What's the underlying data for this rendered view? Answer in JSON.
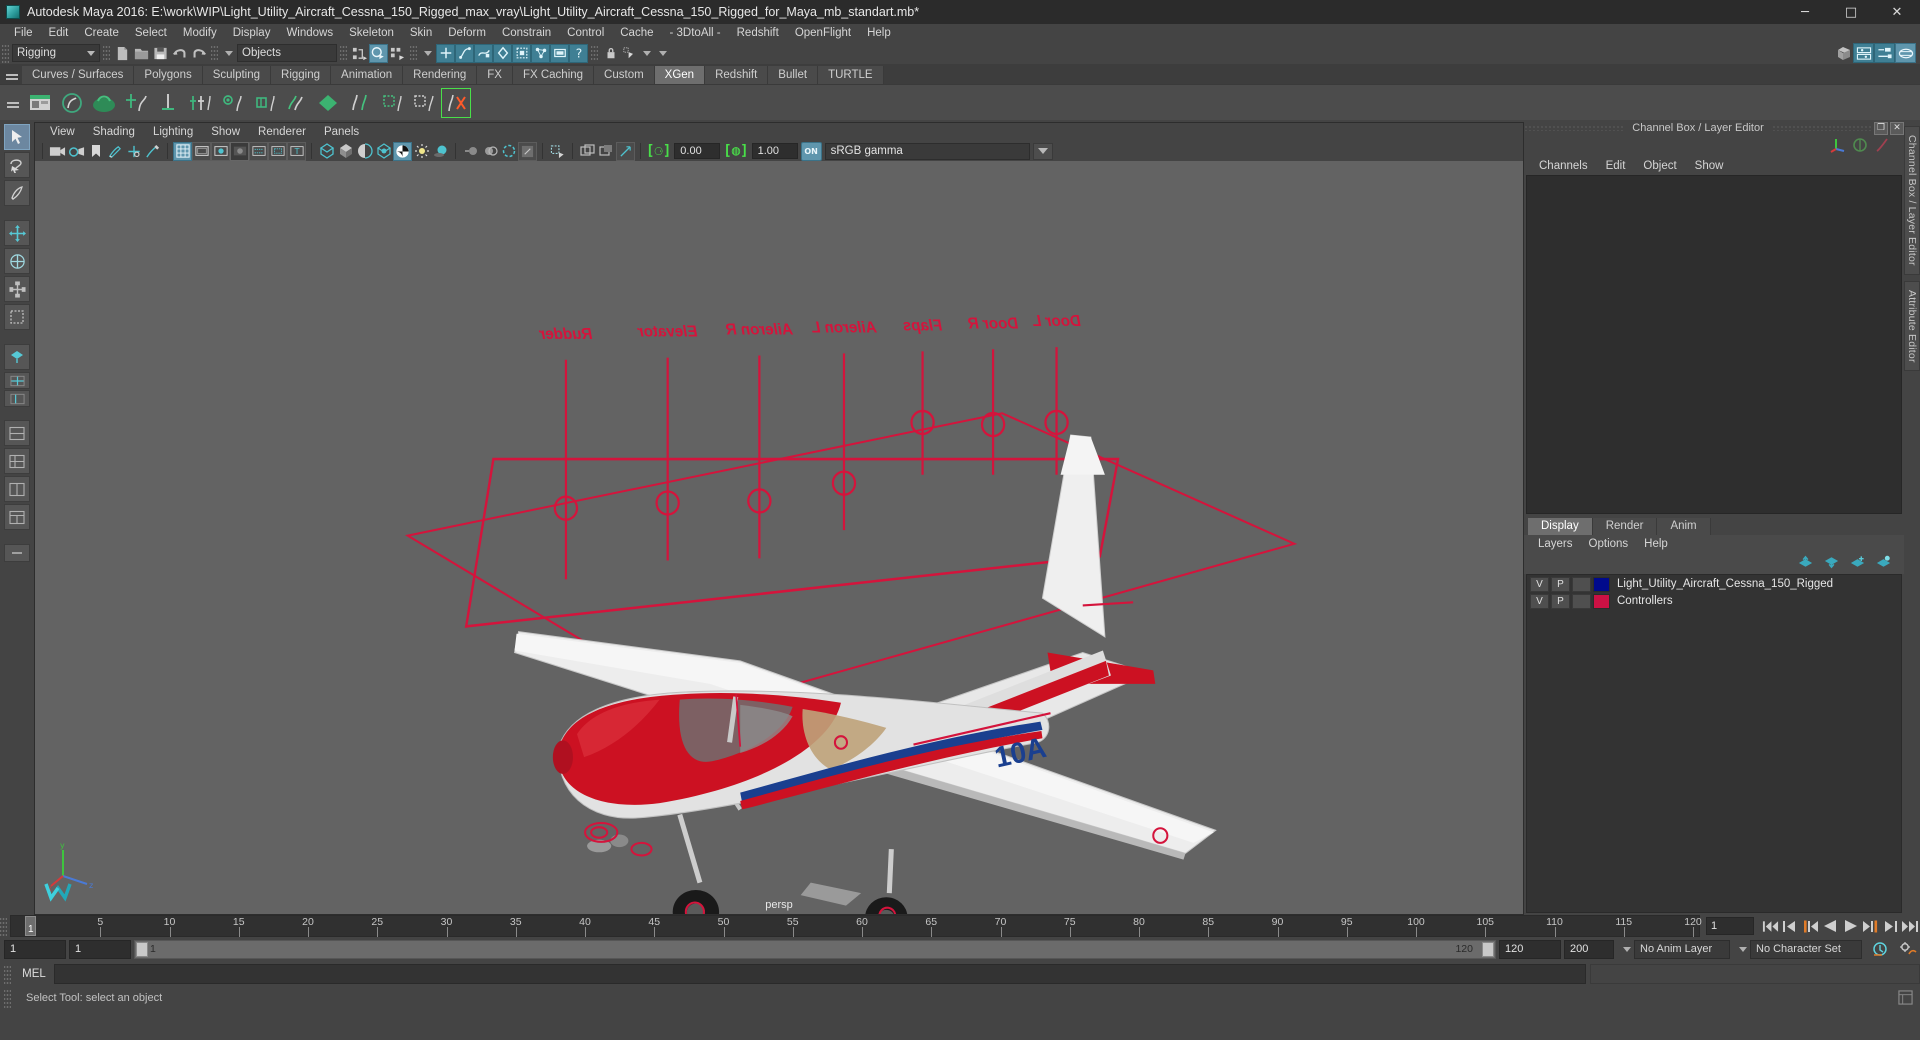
{
  "window": {
    "title": "Autodesk Maya 2016: E:\\work\\WIP\\Light_Utility_Aircraft_Cessna_150_Rigged_max_vray\\Light_Utility_Aircraft_Cessna_150_Rigged_for_Maya_mb_standart.mb*",
    "app_icon": "maya-logo-icon",
    "minimize": "─",
    "maximize": "□",
    "close": "✕"
  },
  "menubar": {
    "items": [
      "File",
      "Edit",
      "Create",
      "Select",
      "Modify",
      "Display",
      "Windows",
      "Skeleton",
      "Skin",
      "Deform",
      "Constrain",
      "Control",
      "Cache",
      "- 3DtoAll -",
      "Redshift",
      "OpenFlight",
      "Help"
    ]
  },
  "statusbar": {
    "menuset": "Rigging",
    "selection_mask": "Objects",
    "icons_left": [
      "new-scene-icon",
      "open-scene-icon",
      "save-scene-icon",
      "undo-icon",
      "redo-icon"
    ],
    "icons_select": [
      "select-hierarchy-icon",
      "select-object-icon",
      "select-component-icon"
    ],
    "icons_masks": [
      "handles-mask-icon",
      "curves-mask-icon",
      "surfaces-mask-icon",
      "deformers-mask-icon",
      "dynamics-mask-icon",
      "rendering-mask-icon",
      "cameras-mask-icon",
      "misc-mask-icon"
    ],
    "icons_lock": [
      "lock-selection-icon",
      "highlight-selection-icon"
    ],
    "icons_right": [
      "show-hide-editors-icon",
      "attribute-editor-icon",
      "tool-settings-icon",
      "channel-box-icon"
    ]
  },
  "shelf": {
    "tabs": [
      "Curves / Surfaces",
      "Polygons",
      "Sculpting",
      "Rigging",
      "Animation",
      "Rendering",
      "FX",
      "FX Caching",
      "Custom",
      "XGen",
      "Redshift",
      "Bullet",
      "TURTLE"
    ],
    "active_tab": "XGen",
    "items": [
      "xgen-window-icon",
      "xgen-create-description-icon",
      "xgen-guide-icon",
      "xgen-add-guide-icon",
      "xgen-sculpt-guide-icon",
      "xgen-move-guide-icon",
      "xgen-lock-guide-icon",
      "xgen-comb-icon",
      "xgen-density-icon",
      "xgen-clumping-icon",
      "xgen-noise-icon",
      "xgen-cut-icon",
      "xgen-region-icon",
      "xgen-export-icon"
    ]
  },
  "toolbox": {
    "items": [
      {
        "name": "select-tool",
        "active": true
      },
      {
        "name": "lasso-select-tool",
        "active": false
      },
      {
        "name": "paint-select-tool",
        "active": false
      },
      {
        "name": "move-tool",
        "active": false
      },
      {
        "name": "rotate-tool",
        "active": false
      },
      {
        "name": "scale-tool",
        "active": false
      },
      {
        "name": "last-tool-used",
        "active": false
      }
    ],
    "layout_items": [
      "single-perspective-layout",
      "four-view-layout",
      "outliner-persp-layout",
      "persp-graph-layout",
      "hypershade-persp-layout",
      "outliner-persp-graph-layout",
      "persp-layout-extra",
      "layout-preset-extra"
    ]
  },
  "viewport": {
    "menu": [
      "View",
      "Shading",
      "Lighting",
      "Show",
      "Renderer",
      "Panels"
    ],
    "camera_icons": [
      "camera-attributes-icon",
      "camera-bookmark-icon",
      "bookmark-icon",
      "grease-pencil-icon",
      "ik-handle-icon",
      "paint-effects-icon"
    ],
    "display_icons": [
      "grid-toggle-icon",
      "film-gate-icon",
      "resolution-gate-icon",
      "gate-mask-icon",
      "field-chart-icon",
      "safe-action-icon",
      "safe-title-icon"
    ],
    "shading_icons": [
      "wireframe-icon",
      "smooth-shade-all-icon",
      "shaded-wireframe-icon",
      "textured-icon",
      "use-all-lights-icon",
      "shadows-icon",
      "screen-space-ao-icon",
      "motion-blur-icon",
      "multisample-icon"
    ],
    "iso_icons": [
      "isolate-select-icon",
      "xray-icon",
      "xray-joints-icon",
      "xray-active-components-icon"
    ],
    "exposure_value": "0.00",
    "gamma_value": "1.00",
    "color_toggle": "ON",
    "color_profile": "sRGB gamma",
    "camera_label": "persp",
    "gizmo": "axis-gizmo",
    "logo": "maya-watermark-icon",
    "scene": {
      "controllers_labels": [
        "Rudder",
        "Elevator",
        "Aileron R",
        "Aileron L",
        "Flaps",
        "Door R",
        "Door L"
      ],
      "aircraft_registration": "10A",
      "rig_color": "#d4143c",
      "body_color": "#cc1122",
      "fuselage_white": "#e4e4e4",
      "stripe_blue": "#1a3f8f"
    }
  },
  "channelbox": {
    "panel_title": "Channel Box / Layer Editor",
    "undock_btn": "❐",
    "close_btn": "✕",
    "tool_icons": [
      "axis-gizmo-icon",
      "rotate-manip-icon",
      "attribute-curve-icon"
    ],
    "menu": [
      "Channels",
      "Edit",
      "Object",
      "Show"
    ],
    "side_tabs": [
      "Channel Box / Layer Editor",
      "Attribute Editor"
    ]
  },
  "layereditor": {
    "tabs": [
      "Display",
      "Render",
      "Anim"
    ],
    "active_tab": "Display",
    "menu": [
      "Layers",
      "Options",
      "Help"
    ],
    "tool_icons": [
      "move-layer-up-icon",
      "move-layer-down-icon",
      "create-new-layer-icon",
      "create-layer-from-selected-icon"
    ],
    "column_headers": [
      "V",
      "P",
      ""
    ],
    "layers": [
      {
        "visible": "V",
        "playback": "P",
        "type": "",
        "color": "#000a8c",
        "name": "Light_Utility_Aircraft_Cessna_150_Rigged"
      },
      {
        "visible": "V",
        "playback": "P",
        "type": "",
        "color": "#cc1144",
        "name": "Controllers"
      }
    ]
  },
  "timeline": {
    "ticks": [
      5,
      10,
      15,
      20,
      25,
      30,
      35,
      40,
      45,
      50,
      55,
      60,
      65,
      70,
      75,
      80,
      85,
      90,
      95,
      100,
      105,
      110,
      115,
      120
    ],
    "range_start": 1,
    "range_end": 120,
    "current_frame": "1",
    "cursor_label": "1",
    "playback_icons": [
      "go-to-start-icon",
      "step-back-keyframe-icon",
      "step-back-frame-icon",
      "play-backwards-icon",
      "play-forwards-icon",
      "step-forward-frame-icon",
      "step-forward-keyframe-icon",
      "go-to-end-icon"
    ],
    "range_fields": {
      "anim_start": "1",
      "range_start": "1",
      "slider_start": "1",
      "slider_end": "120",
      "range_end": "120",
      "anim_end": "200"
    },
    "anim_layer": "No Anim Layer",
    "character_set": "No Character Set",
    "auto_key_icon": "auto-keyframe-icon",
    "anim_prefs_icon": "animation-preferences-icon"
  },
  "commandline": {
    "label": "MEL",
    "input_value": "",
    "output_value": ""
  },
  "helpline": {
    "text": "Select Tool: select an object",
    "icon": "help-line-icon"
  }
}
